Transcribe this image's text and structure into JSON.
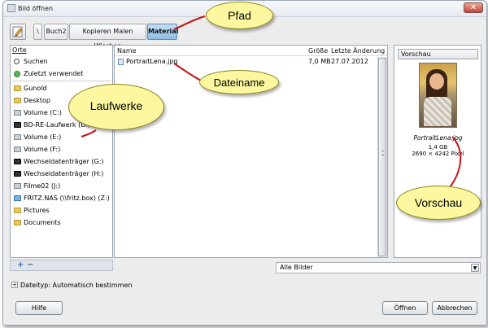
{
  "window": {
    "title": "Bild öffnen",
    "close_glyph": "✕"
  },
  "path_bar": {
    "segments": [
      {
        "label": "\\"
      },
      {
        "label": "Buch2"
      },
      {
        "label": "Kopieren Malen Wischen"
      },
      {
        "label": "Material"
      }
    ],
    "active_index": 3
  },
  "places": {
    "header": "Orte",
    "items": [
      {
        "label": "Suchen",
        "icon": "search-icon"
      },
      {
        "label": "Zuletzt verwendet",
        "icon": "recent-icon"
      },
      {
        "label": "Gunold",
        "icon": "folder-icon"
      },
      {
        "label": "Desktop",
        "icon": "folder-icon"
      },
      {
        "label": "Volume (C:)",
        "icon": "drive-icon"
      },
      {
        "label": "BD-RE-Laufwerk (D:)",
        "icon": "disc-icon"
      },
      {
        "label": "Volume (E:)",
        "icon": "drive-icon"
      },
      {
        "label": "Volume (F:)",
        "icon": "drive-icon"
      },
      {
        "label": "Wechseldatenträger (G:)",
        "icon": "disc-icon"
      },
      {
        "label": "Wechseldatenträger (H:)",
        "icon": "disc-icon"
      },
      {
        "label": "Filme02 (J:)",
        "icon": "drive-icon"
      },
      {
        "label": "FRITZ.NAS (\\\\fritz.box) (Z:)",
        "icon": "network-icon"
      },
      {
        "label": "Pictures",
        "icon": "folder-icon"
      },
      {
        "label": "Documents",
        "icon": "folder-icon"
      }
    ],
    "add_symbol": "+",
    "remove_symbol": "−"
  },
  "files": {
    "columns": {
      "name": "Name",
      "size": "Größe",
      "modified": "Letzte Änderung"
    },
    "rows": [
      {
        "name": "PortraitLena.jpg",
        "size": "7,0 MB",
        "modified": "27.07.2012"
      }
    ]
  },
  "preview": {
    "header": "Vorschau",
    "filename": "PortraitLena.jpg",
    "filesize": "1,4 GB",
    "dimensions": "2690 × 4242 Pixel"
  },
  "filter": {
    "selected": "Alle Bilder",
    "arrow": "▼"
  },
  "filetype": {
    "toggle": "+",
    "label": "Dateityp: Automatisch bestimmen"
  },
  "buttons": {
    "help": "Hilfe",
    "open": "Öffnen",
    "cancel": "Abbrechen"
  },
  "callouts": {
    "path": "Pfad",
    "filename": "Dateiname",
    "drives": "Laufwerke",
    "preview": "Vorschau"
  },
  "colors": {
    "callout_fill": "#fdf8a0",
    "callout_line": "#c0141b",
    "active_path": "#8fbde3",
    "selection": "#cfe3f7"
  }
}
